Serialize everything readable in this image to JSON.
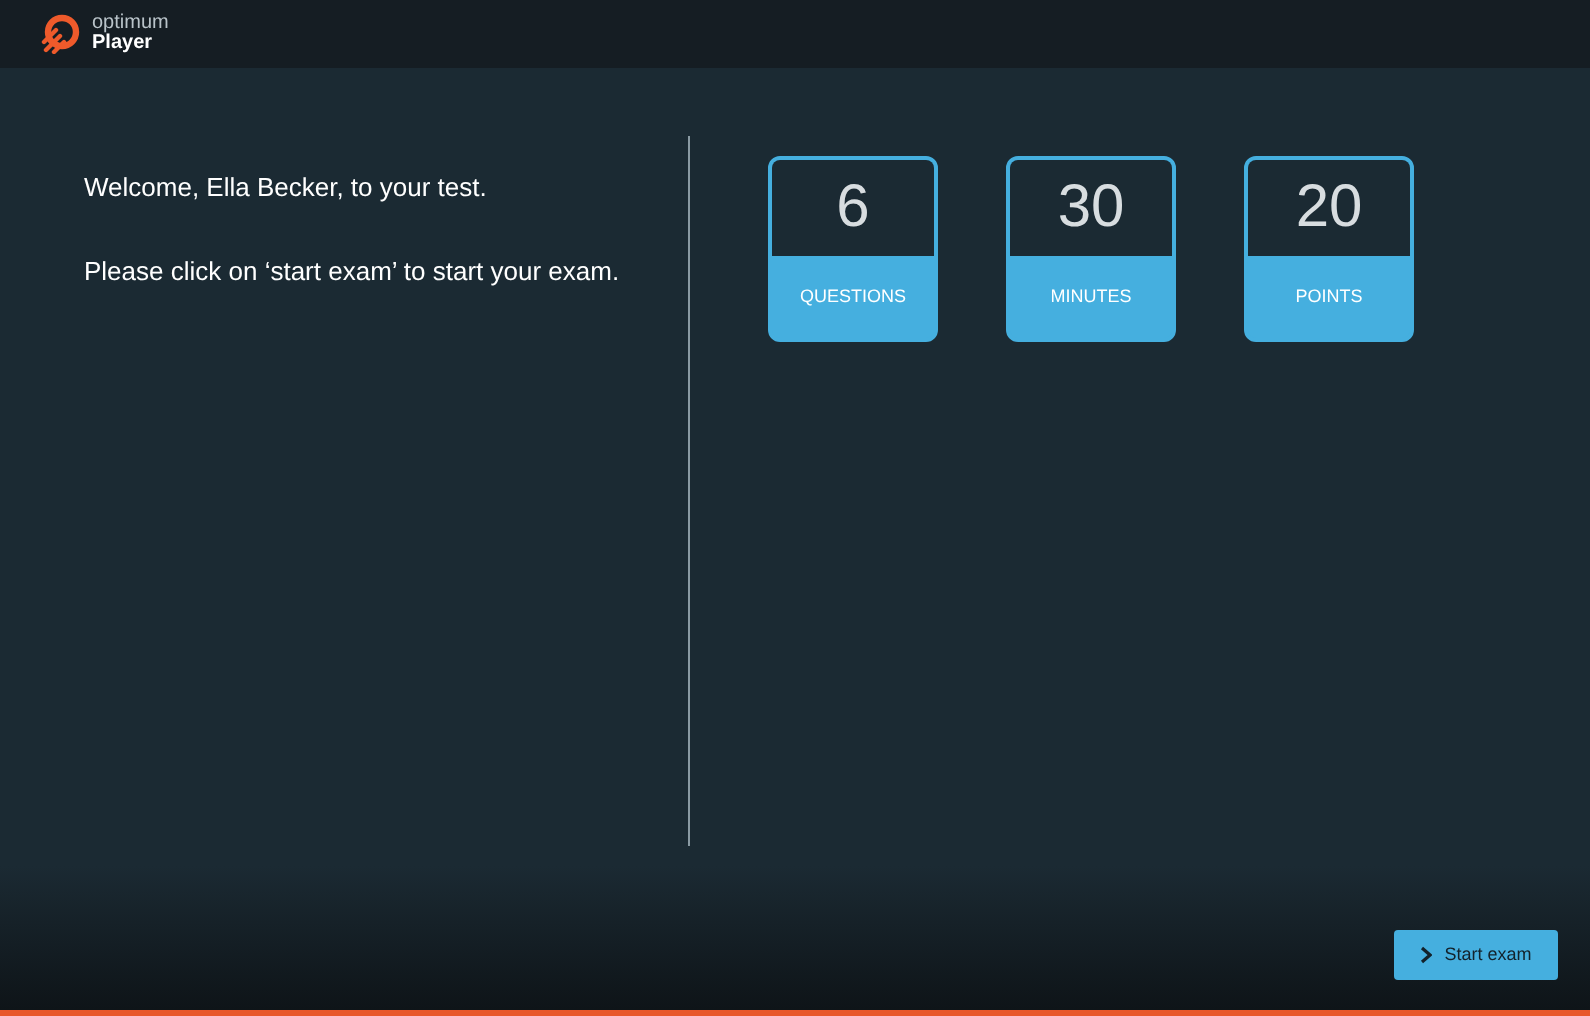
{
  "header": {
    "brand_top": "optimum",
    "brand_bottom": "Player"
  },
  "welcome": "Welcome, Ella Becker, to your test.",
  "instruction": "Please click on ‘start exam’ to start your exam.",
  "stats": [
    {
      "value": "6",
      "label": "QUESTIONS"
    },
    {
      "value": "30",
      "label": "MINUTES"
    },
    {
      "value": "20",
      "label": "POINTS"
    }
  ],
  "start_button": {
    "label": "Start exam"
  }
}
